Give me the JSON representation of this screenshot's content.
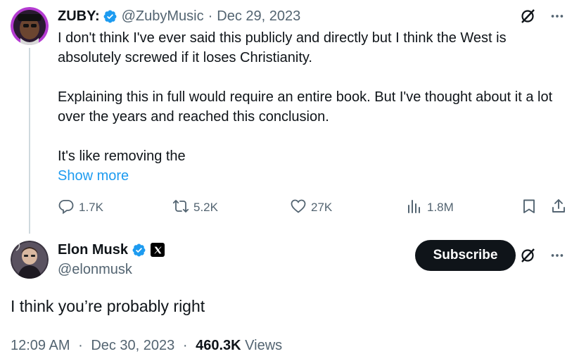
{
  "parent_tweet": {
    "author_name": "ZUBY:",
    "author_handle": "@ZubyMusic",
    "separator": "·",
    "date": "Dec 29, 2023",
    "text_paragraphs": [
      "I don't think I've ever said this publicly and directly but I think the West is absolutely screwed if it loses Christianity.",
      "Explaining this in full would require an entire book. But I've thought about it a lot over the years and reached this conclusion.",
      "It's like removing the"
    ],
    "show_more": "Show more",
    "stats": {
      "replies": "1.7K",
      "reposts": "5.2K",
      "likes": "27K",
      "views": "1.8M"
    }
  },
  "main_tweet": {
    "author_name": "Elon Musk",
    "author_handle": "@elonmusk",
    "subscribe_label": "Subscribe",
    "text": "I think you’re probably right",
    "time": "12:09 AM",
    "date": "Dec 30, 2023",
    "separator": "·",
    "views_count": "460.3K",
    "views_label": "Views"
  },
  "colors": {
    "text": "#0f1419",
    "secondary": "#536471",
    "link": "#1d9bf0",
    "verified": "#1d9bf0",
    "thread_line": "#cfd9de"
  },
  "icons": [
    "verified-badge-icon",
    "grok-icon",
    "more-icon",
    "reply-icon",
    "repost-icon",
    "like-icon",
    "views-icon",
    "bookmark-icon",
    "share-icon",
    "x-logo-icon"
  ]
}
